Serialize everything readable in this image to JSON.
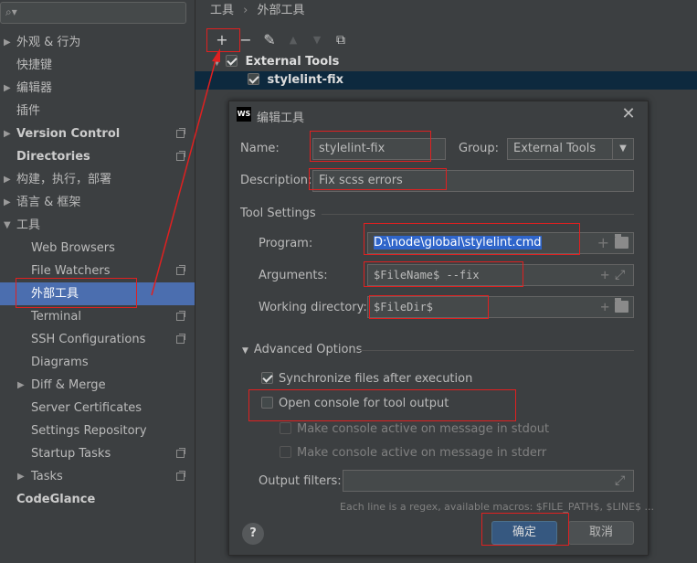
{
  "sidebar": {
    "search_placeholder": "",
    "items": [
      {
        "label": "外观 & 行为",
        "arrow": "▶"
      },
      {
        "label": "快捷键"
      },
      {
        "label": "编辑器",
        "arrow": "▶"
      },
      {
        "label": "插件"
      },
      {
        "label": "Version Control",
        "arrow": "▶"
      },
      {
        "label": "Directories"
      },
      {
        "label": "构建，执行，部署",
        "arrow": "▶"
      },
      {
        "label": "语言 & 框架",
        "arrow": "▶"
      },
      {
        "label": "工具",
        "arrow": "▼"
      },
      {
        "label": "Web Browsers"
      },
      {
        "label": "File Watchers"
      },
      {
        "label": "外部工具"
      },
      {
        "label": "Terminal"
      },
      {
        "label": "SSH Configurations"
      },
      {
        "label": "Diagrams"
      },
      {
        "label": "Diff & Merge",
        "arrow": "▶"
      },
      {
        "label": "Server Certificates"
      },
      {
        "label": "Settings Repository"
      },
      {
        "label": "Startup Tasks"
      },
      {
        "label": "Tasks",
        "arrow": "▶"
      },
      {
        "label": "CodeGlance"
      }
    ]
  },
  "breadcrumb": {
    "parent": "工具",
    "sep": "›",
    "current": "外部工具"
  },
  "toolbar": {
    "add": "+",
    "remove": "−",
    "edit": "✎",
    "up": "▲",
    "down": "▼",
    "copy": "⧉"
  },
  "tree": {
    "group": "External Tools",
    "group_arrow": "▼",
    "item": "stylelint-fix"
  },
  "dialog": {
    "logo": "WS",
    "title": "编辑工具",
    "close": "✕",
    "name_label": "Name:",
    "name_value": "stylelint-fix",
    "group_label": "Group:",
    "group_value": "External Tools",
    "description_label": "Description:",
    "description_value": "Fix scss errors",
    "tool_settings": "Tool Settings",
    "program_label": "Program:",
    "program_value": "D:\\node\\global\\stylelint.cmd",
    "arguments_label": "Arguments:",
    "arguments_value": "$FileName$ --fix",
    "workdir_label": "Working directory:",
    "workdir_value": "$FileDir$",
    "advanced_options": "Advanced Options",
    "advanced_arrow": "▼",
    "sync_label": "Synchronize files after execution",
    "console_label": "Open console for tool output",
    "stdout_label": "Make console active on message in stdout",
    "stderr_label": "Make console active on message in stderr",
    "output_filters_label": "Output filters:",
    "hint": "Each line is a regex, available macros: $FILE_PATH$, $LINE$ ...",
    "help": "?",
    "ok": "确定",
    "cancel": "取消"
  },
  "colors": {
    "annotation": "#e02020",
    "selection": "#4b6eaf",
    "primary_button": "#365880"
  }
}
